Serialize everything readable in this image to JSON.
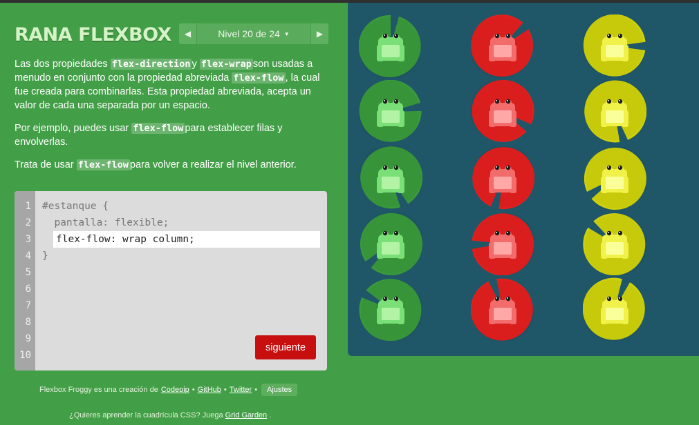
{
  "app": {
    "title": "RANA FLEXBOX",
    "level_label": "Nivel 20 de 24"
  },
  "instructions": {
    "p1": {
      "t1": "Las dos propiedades ",
      "c1": "flex-direction",
      "t2": "y ",
      "c2": "flex-wrap",
      "t3": "son usadas a menudo en conjunto con la propiedad abreviada ",
      "c3": "flex-flow",
      "t4": ", la cual fue creada para combinarlas. Esta propiedad abreviada, acepta un valor de cada una separada por un espacio."
    },
    "p2": {
      "t1": "Por ejemplo, puedes usar ",
      "c1": "flex-flow",
      "t2": "para establecer filas y envolverlas."
    },
    "p3": {
      "t1": "Trata de usar ",
      "c1": "flex-flow",
      "t2": "para volver a realizar el nivel anterior."
    }
  },
  "editor": {
    "line_numbers": [
      "1",
      "2",
      "3",
      "4",
      "5",
      "6",
      "7",
      "8",
      "9",
      "10"
    ],
    "line1": "#estanque {",
    "line2": "  pantalla: flexible;",
    "input_value": "flex-flow: wrap column;",
    "line4": "}",
    "next_label": "siguiente"
  },
  "footer": {
    "credit_prefix": "Flexbox Froggy es una creación de",
    "codepip": "Codepip",
    "sep1": "•",
    "github": "GitHub",
    "sep2": "•",
    "twitter": "Twitter",
    "sep3": "•",
    "settings": "Ajustes",
    "grid_prefix": "¿Quieres aprender la cuadrícula CSS? Juega",
    "grid_link": "Grid Garden",
    "grid_suffix": "."
  },
  "board": {
    "columns": [
      {
        "color": "green",
        "lily": "#3a9a3c",
        "frog": "#7bdf78",
        "frog_light": "#b2f3a6"
      },
      {
        "color": "red",
        "lily": "#e21f1f",
        "frog": "#f36c6c",
        "frog_light": "#ffa8a8"
      },
      {
        "color": "yellow",
        "lily": "#cfd10c",
        "frog": "#f0f24a",
        "frog_light": "#fbff9a"
      }
    ],
    "rows": 5
  }
}
